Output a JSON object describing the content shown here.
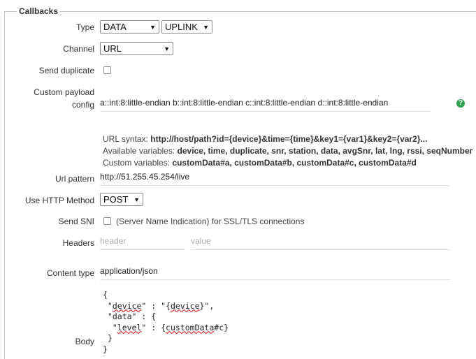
{
  "section_title": "Callbacks",
  "type": {
    "label": "Type",
    "value": "DATA",
    "direction": "UPLINK"
  },
  "channel": {
    "label": "Channel",
    "value": "URL"
  },
  "send_duplicate": {
    "label": "Send duplicate",
    "checked": false
  },
  "custom_payload": {
    "label_line1": "Custom payload",
    "label_line2": "config",
    "value": "a::int:8:little-endian b::int:8:little-endian c::int:8:little-endian d::int:8:little-endian",
    "help_icon": "?"
  },
  "url_syntax": {
    "prefix": "URL syntax:",
    "value": "http://host/path?id={device}&time={time}&key1={var1}&key2={var2}...",
    "available_prefix": "Available variables:",
    "available": "device, time, duplicate, snr, station, data, avgSnr, lat, lng, rssi, seqNumber",
    "custom_prefix": "Custom variables:",
    "custom": "customData#a, customData#b, customData#c, customData#d"
  },
  "url_pattern": {
    "label": "Url pattern",
    "value": "http://51.255.45.254/live"
  },
  "http_method": {
    "label": "Use HTTP Method",
    "value": "POST"
  },
  "send_sni": {
    "label": "Send SNI",
    "checked": false,
    "description": "(Server Name Indication) for SSL/TLS connections"
  },
  "headers": {
    "label": "Headers",
    "header_placeholder": "header",
    "value_placeholder": "value"
  },
  "content_type": {
    "label": "Content type",
    "value": "application/json"
  },
  "body": {
    "label": "Body",
    "lines": {
      "l1": "{",
      "l2a": " \"",
      "l2b": "device",
      "l2c": "\" : \"{",
      "l2d": "device",
      "l2e": "}\",",
      "l3": " \"data\" : {",
      "l4a": "  \"",
      "l4b": "level",
      "l4c": "\" : {",
      "l4d": "customData",
      "l4e": "#c}",
      "l5": " }",
      "l6": "}"
    }
  }
}
